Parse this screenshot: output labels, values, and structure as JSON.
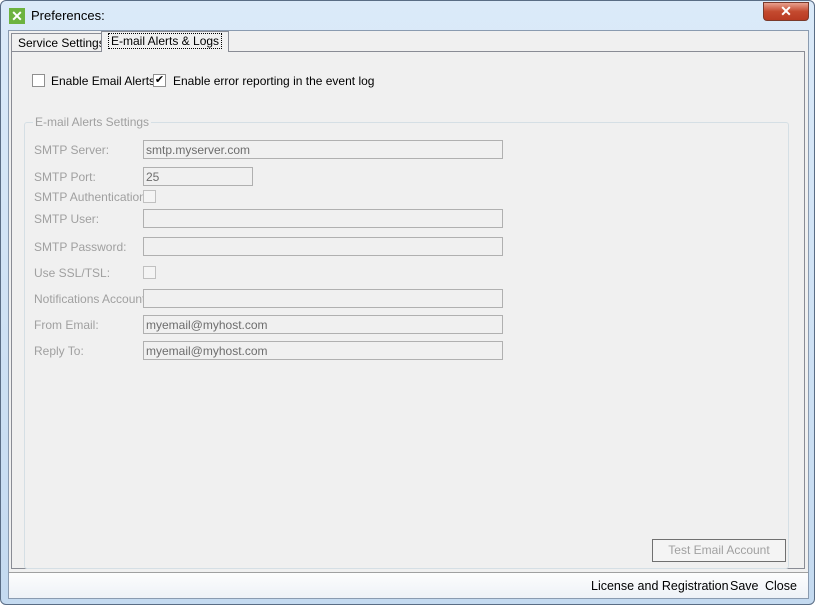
{
  "window": {
    "title": "Preferences:",
    "icon": "app-x-icon",
    "close_glyph": "✕"
  },
  "tabs": [
    {
      "label": "Service Settings",
      "active": false
    },
    {
      "label": "E-mail Alerts & Logs",
      "active": true
    }
  ],
  "options": {
    "enable_email_alerts": {
      "label": "Enable Email Alerts",
      "checked": false
    },
    "enable_error_reporting": {
      "label": "Enable error reporting in the event log",
      "checked": true
    }
  },
  "group": {
    "title": "E-mail Alerts Settings",
    "fields": {
      "smtp_server": {
        "label": "SMTP Server:",
        "value": "smtp.myserver.com"
      },
      "smtp_port": {
        "label": "SMTP Port:",
        "value": "25"
      },
      "smtp_auth": {
        "label": "SMTP Authentication:",
        "checked": false
      },
      "smtp_user": {
        "label": "SMTP User:",
        "value": ""
      },
      "smtp_password": {
        "label": "SMTP Password:",
        "value": ""
      },
      "use_ssl": {
        "label": "Use SSL/TSL:",
        "checked": false
      },
      "notifications_account": {
        "label": "Notifications Account:",
        "value": ""
      },
      "from_email": {
        "label": "From Email:",
        "value": "myemail@myhost.com"
      },
      "reply_to": {
        "label": "Reply To:",
        "value": "myemail@myhost.com"
      }
    },
    "test_button": "Test Email Account"
  },
  "status": {
    "license": "License and Registration",
    "save": "Save",
    "close": "Close"
  },
  "colors": {
    "accent_icon": "#6db33f",
    "close_button": "#c44a2f"
  }
}
